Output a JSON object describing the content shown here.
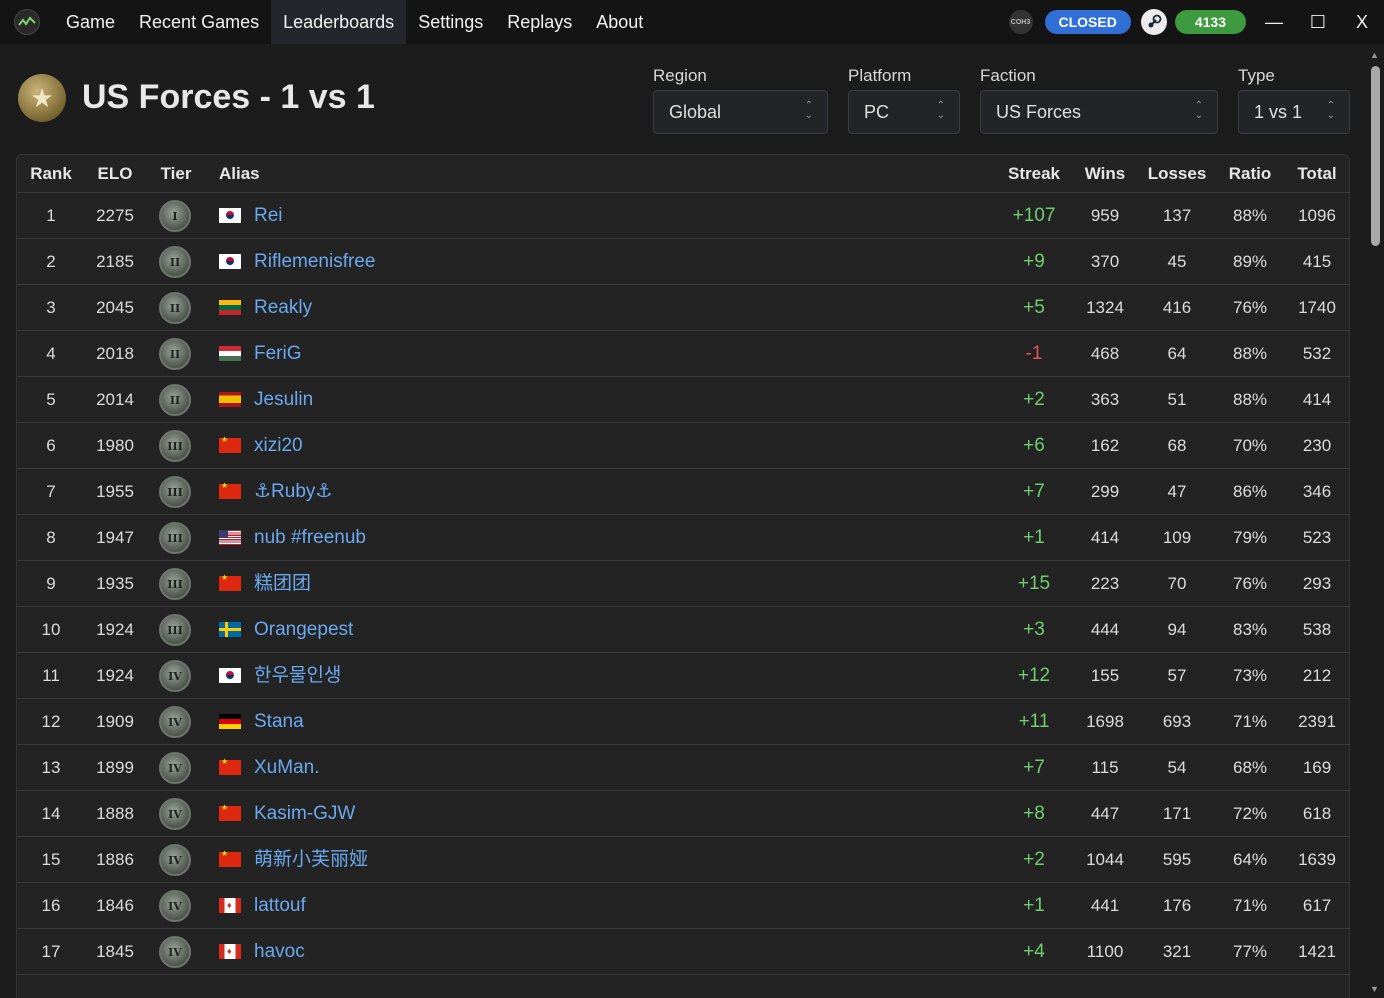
{
  "topbar": {
    "nav": [
      "Game",
      "Recent Games",
      "Leaderboards",
      "Settings",
      "Replays",
      "About"
    ],
    "active_nav": "Leaderboards",
    "coh_badge": "COH3",
    "status_pill": "CLOSED",
    "player_count": "4133",
    "minimize": "—",
    "maximize": "☐",
    "close": "X"
  },
  "header": {
    "title": "US Forces - 1 vs 1",
    "region": {
      "label": "Region",
      "value": "Global"
    },
    "platform": {
      "label": "Platform",
      "value": "PC"
    },
    "faction": {
      "label": "Faction",
      "value": "US Forces"
    },
    "type": {
      "label": "Type",
      "value": "1 vs 1"
    }
  },
  "table": {
    "columns": [
      "Rank",
      "ELO",
      "Tier",
      "Alias",
      "Streak",
      "Wins",
      "Losses",
      "Ratio",
      "Total"
    ],
    "rows": [
      {
        "rank": "1",
        "elo": "2275",
        "tier": "I",
        "flag": "kr",
        "alias": "Rei",
        "streak": "+107",
        "wins": "959",
        "losses": "137",
        "ratio": "88%",
        "total": "1096"
      },
      {
        "rank": "2",
        "elo": "2185",
        "tier": "II",
        "flag": "kr",
        "alias": "Riflemenisfree",
        "streak": "+9",
        "wins": "370",
        "losses": "45",
        "ratio": "89%",
        "total": "415"
      },
      {
        "rank": "3",
        "elo": "2045",
        "tier": "II",
        "flag": "lt",
        "alias": "Reakly",
        "streak": "+5",
        "wins": "1324",
        "losses": "416",
        "ratio": "76%",
        "total": "1740"
      },
      {
        "rank": "4",
        "elo": "2018",
        "tier": "II",
        "flag": "hu",
        "alias": "FeriG",
        "streak": "-1",
        "wins": "468",
        "losses": "64",
        "ratio": "88%",
        "total": "532"
      },
      {
        "rank": "5",
        "elo": "2014",
        "tier": "II",
        "flag": "es",
        "alias": "Jesulin",
        "streak": "+2",
        "wins": "363",
        "losses": "51",
        "ratio": "88%",
        "total": "414"
      },
      {
        "rank": "6",
        "elo": "1980",
        "tier": "III",
        "flag": "cn",
        "alias": "xizi20",
        "streak": "+6",
        "wins": "162",
        "losses": "68",
        "ratio": "70%",
        "total": "230"
      },
      {
        "rank": "7",
        "elo": "1955",
        "tier": "III",
        "flag": "cn",
        "alias": "⚓Ruby⚓",
        "streak": "+7",
        "wins": "299",
        "losses": "47",
        "ratio": "86%",
        "total": "346"
      },
      {
        "rank": "8",
        "elo": "1947",
        "tier": "III",
        "flag": "us",
        "alias": "nub #freenub",
        "streak": "+1",
        "wins": "414",
        "losses": "109",
        "ratio": "79%",
        "total": "523"
      },
      {
        "rank": "9",
        "elo": "1935",
        "tier": "III",
        "flag": "cn",
        "alias": "糕团团",
        "streak": "+15",
        "wins": "223",
        "losses": "70",
        "ratio": "76%",
        "total": "293"
      },
      {
        "rank": "10",
        "elo": "1924",
        "tier": "III",
        "flag": "se",
        "alias": "Orangepest",
        "streak": "+3",
        "wins": "444",
        "losses": "94",
        "ratio": "83%",
        "total": "538"
      },
      {
        "rank": "11",
        "elo": "1924",
        "tier": "IV",
        "flag": "kr",
        "alias": "한우물인생",
        "streak": "+12",
        "wins": "155",
        "losses": "57",
        "ratio": "73%",
        "total": "212"
      },
      {
        "rank": "12",
        "elo": "1909",
        "tier": "IV",
        "flag": "de",
        "alias": "Stana",
        "streak": "+11",
        "wins": "1698",
        "losses": "693",
        "ratio": "71%",
        "total": "2391"
      },
      {
        "rank": "13",
        "elo": "1899",
        "tier": "IV",
        "flag": "cn",
        "alias": "XuMan.",
        "streak": "+7",
        "wins": "115",
        "losses": "54",
        "ratio": "68%",
        "total": "169"
      },
      {
        "rank": "14",
        "elo": "1888",
        "tier": "IV",
        "flag": "cn",
        "alias": "Kasim-GJW",
        "streak": "+8",
        "wins": "447",
        "losses": "171",
        "ratio": "72%",
        "total": "618"
      },
      {
        "rank": "15",
        "elo": "1886",
        "tier": "IV",
        "flag": "cn",
        "alias": "萌新小芙丽娅",
        "streak": "+2",
        "wins": "1044",
        "losses": "595",
        "ratio": "64%",
        "total": "1639"
      },
      {
        "rank": "16",
        "elo": "1846",
        "tier": "IV",
        "flag": "ca",
        "alias": "lattouf",
        "streak": "+1",
        "wins": "441",
        "losses": "176",
        "ratio": "71%",
        "total": "617"
      },
      {
        "rank": "17",
        "elo": "1845",
        "tier": "IV",
        "flag": "ca",
        "alias": "havoc",
        "streak": "+4",
        "wins": "1100",
        "losses": "321",
        "ratio": "77%",
        "total": "1421"
      }
    ]
  },
  "colors": {
    "accent_blue": "#2f6fd6",
    "player_count_green": "#3e9a3e",
    "alias_link": "#6aa9f0",
    "streak_positive": "#6fcf6f",
    "streak_negative": "#e05555"
  }
}
